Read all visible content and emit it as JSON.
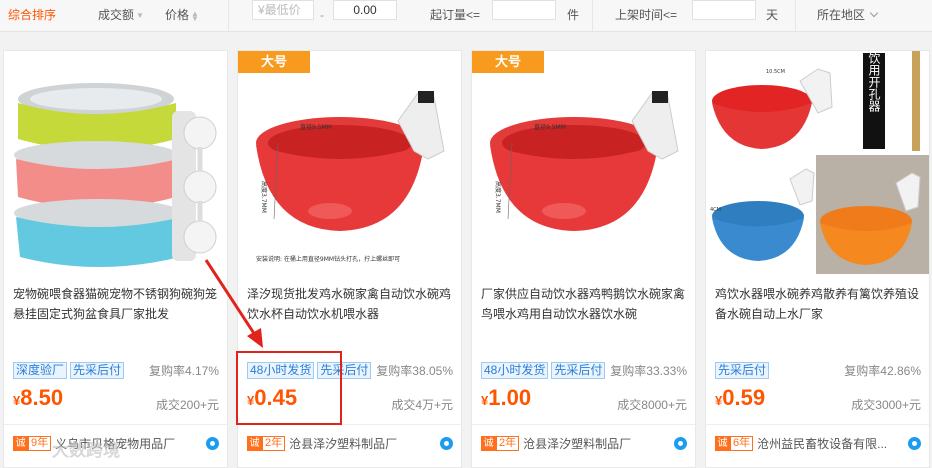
{
  "filter_bar": {
    "sort_default": "综合排序",
    "sort_volume": "成交额",
    "sort_price": "价格",
    "min_price_placeholder": "¥最低价",
    "price_dash": "-",
    "max_price_value": "0.00",
    "moq_label": "起订量<=",
    "moq_unit": "件",
    "listed_label": "上架时间<=",
    "listed_unit": "天",
    "region_label": "所在地区"
  },
  "products": [
    {
      "badge": "",
      "title": "宠物碗喂食器猫碗宠物不锈钢狗碗狗笼悬挂固定式狗盆食具厂家批发",
      "tags": [
        "深度验厂",
        "先采后付"
      ],
      "rebuy": "复购率4.17%",
      "currency": "¥",
      "price": "8.50",
      "deal": "成交200+元",
      "cheng": "诚",
      "years": "9年",
      "shop": "义乌市贝格宠物用品厂"
    },
    {
      "badge": "大号",
      "title": "泽汐现货批发鸡水碗家禽自动饮水碗鸡饮水杯自动饮水机喂水器",
      "tags": [
        "48小时发货",
        "先采后付"
      ],
      "rebuy": "复购率38.05%",
      "currency": "¥",
      "price": "0.45",
      "deal": "成交4万+元",
      "cheng": "诚",
      "years": "2年",
      "shop": "沧县泽汐塑料制品厂"
    },
    {
      "badge": "大号",
      "title": "厂家供应自动饮水器鸡鸭鹅饮水碗家禽鸟喂水鸡用自动饮水器饮水碗",
      "tags": [
        "48小时发货",
        "先采后付"
      ],
      "rebuy": "复购率33.33%",
      "currency": "¥",
      "price": "1.00",
      "deal": "成交8000+元",
      "cheng": "诚",
      "years": "2年",
      "shop": "沧县泽汐塑料制品厂"
    },
    {
      "badge": "",
      "title": "鸡饮水器喂水碗养鸡散养有篱饮养殖设备水碗自动上水厂家",
      "tags": [
        "先采后付"
      ],
      "rebuy": "复购率42.86%",
      "currency": "¥",
      "price": "0.59",
      "deal": "成交3000+元",
      "cheng": "诚",
      "years": "6年",
      "shop": "沧州益民畜牧设备有限..."
    }
  ],
  "image_text": {
    "dim_diameter": "直径9.5MM",
    "dim_height": "高度3.7MM",
    "install_note": "安装说明: 在桶上用直径9MM钻头打孔，拧上螺丝即可",
    "side_label": "图上饮用开孔器",
    "dim_10cm": "10.5CM",
    "dim_4cm": "4CM"
  },
  "watermark": "大数跨境",
  "colors": {
    "accent": "#ff5500",
    "tag_blue": "#2c7ed6",
    "badge_orange": "#f79a1e",
    "highlight_red": "#e0231b"
  }
}
